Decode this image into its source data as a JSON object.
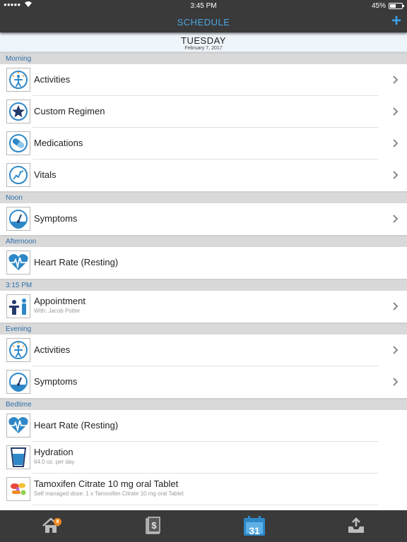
{
  "status_bar": {
    "time": "3:45 PM",
    "battery": "45%",
    "signal": "●●●●●"
  },
  "nav": {
    "title": "SCHEDULE",
    "add_symbol": "+"
  },
  "date_header": {
    "day": "TUESDAY",
    "date": "February 7, 2017"
  },
  "sections": [
    {
      "title": "Morning",
      "items": [
        {
          "label": "Activities",
          "icon": "activities-icon",
          "chevron": true
        },
        {
          "label": "Custom Regimen",
          "icon": "star-icon",
          "chevron": true
        },
        {
          "label": "Medications",
          "icon": "pill-icon",
          "chevron": true
        },
        {
          "label": "Vitals",
          "icon": "vitals-graph-icon",
          "chevron": true
        }
      ]
    },
    {
      "title": "Noon",
      "items": [
        {
          "label": "Symptoms",
          "icon": "gauge-icon",
          "chevron": true
        }
      ]
    },
    {
      "title": "Afternoon",
      "items": [
        {
          "label": "Heart Rate (Resting)",
          "icon": "heart-rate-icon",
          "chevron": false
        }
      ]
    },
    {
      "title": "3:15 PM",
      "items": [
        {
          "label": "Appointment",
          "sub": "With: Jacob Potter",
          "icon": "appointment-icon",
          "chevron": true
        }
      ]
    },
    {
      "title": "Evening",
      "items": [
        {
          "label": "Activities",
          "icon": "activities-icon",
          "chevron": true
        },
        {
          "label": "Symptoms",
          "icon": "gauge-icon",
          "chevron": true
        }
      ]
    },
    {
      "title": "Bedtime",
      "items": [
        {
          "label": "Heart Rate (Resting)",
          "icon": "heart-rate-icon",
          "chevron": false
        },
        {
          "label": "Hydration",
          "sub": "64.0 oz. per day",
          "icon": "water-glass-icon",
          "chevron": false
        },
        {
          "label": "Tamoxifen Citrate 10 mg oral Tablet",
          "sub": "Self managed dose: 1 x Tamoxifen Citrate 10 mg oral Tablet",
          "icon": "pills-icon",
          "chevron": false
        }
      ]
    }
  ],
  "tab_bar": {
    "home_badge": "8",
    "calendar_day": "31",
    "tabs": [
      "home-icon",
      "billing-icon",
      "calendar-icon",
      "inbox-icon"
    ]
  },
  "colors": {
    "accent": "#2e88c8",
    "header_text": "#2e6fa8",
    "bars": "#3a3a3a",
    "badge": "#f08a1e"
  }
}
